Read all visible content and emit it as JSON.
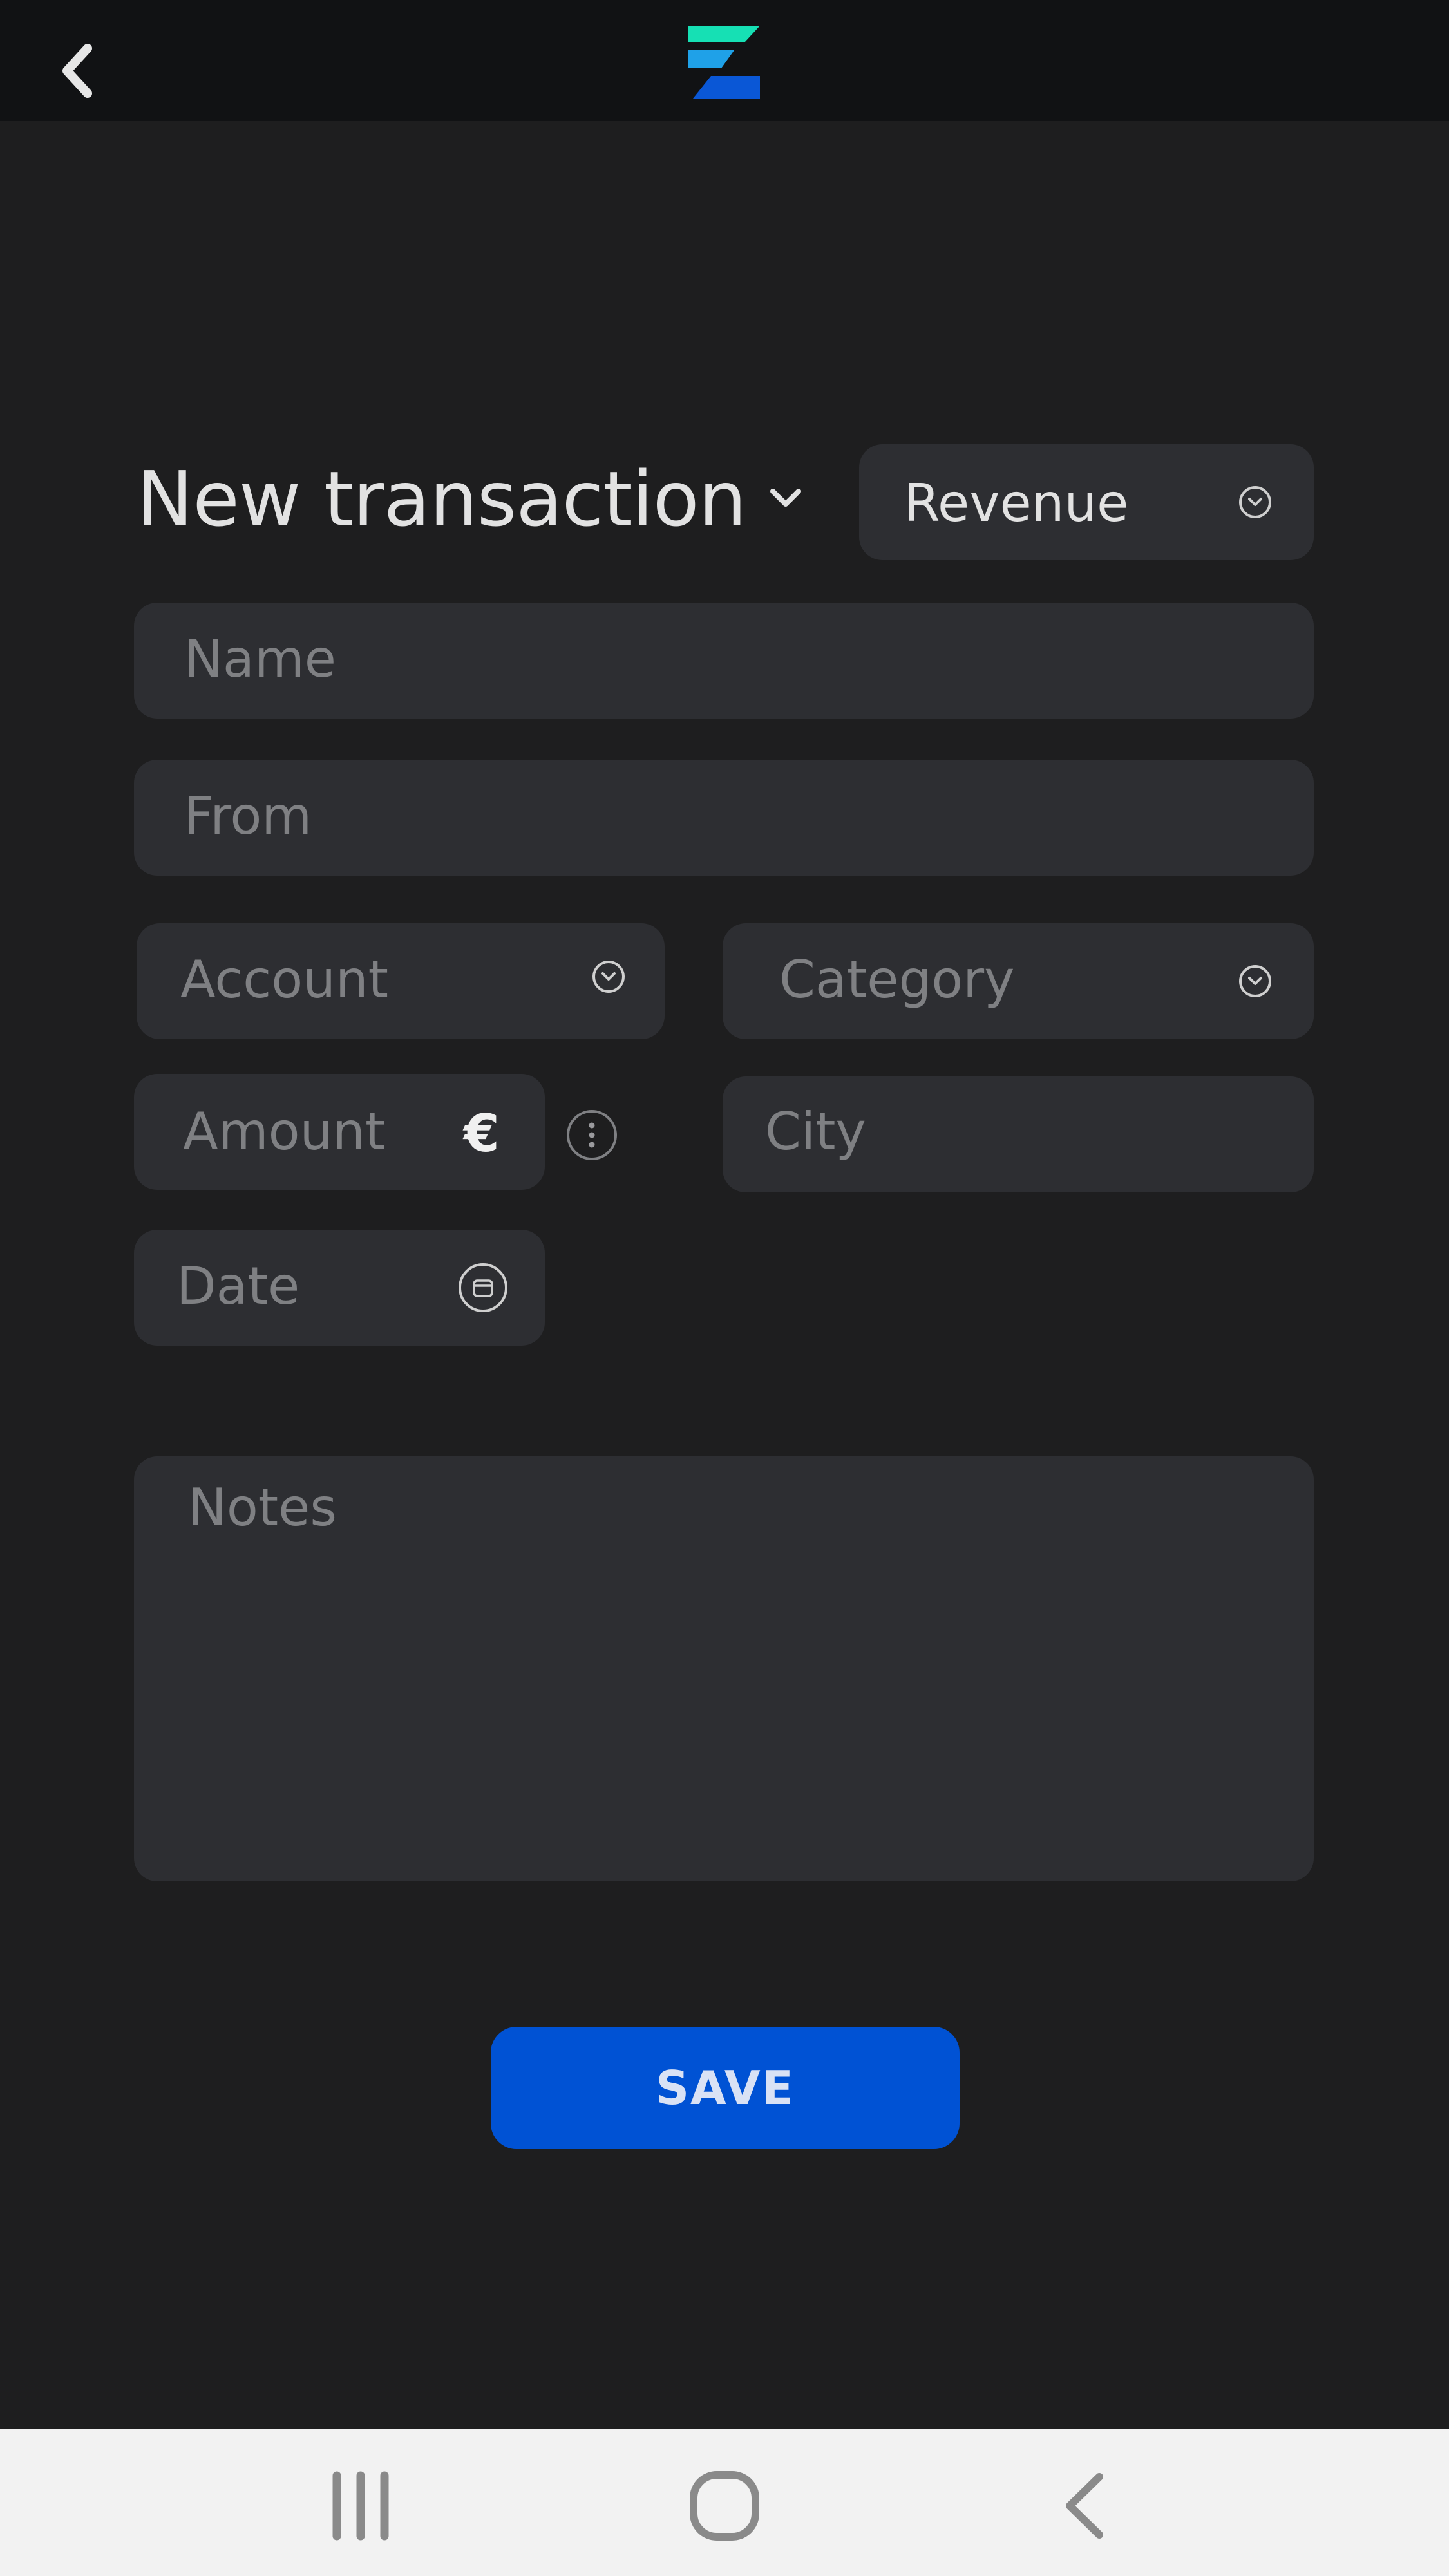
{
  "header": {
    "back_icon": "chevron-left-icon",
    "logo_icon": "app-logo",
    "logo_colors": [
      "#16e0b4",
      "#1fa1e8",
      "#0a57d6"
    ]
  },
  "form": {
    "title": "New transaction",
    "type_select": {
      "value": "Revenue"
    },
    "name_placeholder": "Name",
    "from_placeholder": "From",
    "account_placeholder": "Account",
    "category_placeholder": "Category",
    "amount_placeholder": "Amount",
    "currency_symbol": "€",
    "city_placeholder": "City",
    "date_placeholder": "Date",
    "notes_placeholder": "Notes",
    "save_label": "SAVE"
  },
  "colors": {
    "background": "#1e1e1f",
    "field": "#2d2e32",
    "accent": "#0052d4",
    "topbar": "#111214",
    "navbar": "#f2f2f2"
  },
  "system_nav": {
    "recents_icon": "recents-icon",
    "home_icon": "home-icon",
    "back_icon": "back-icon"
  }
}
